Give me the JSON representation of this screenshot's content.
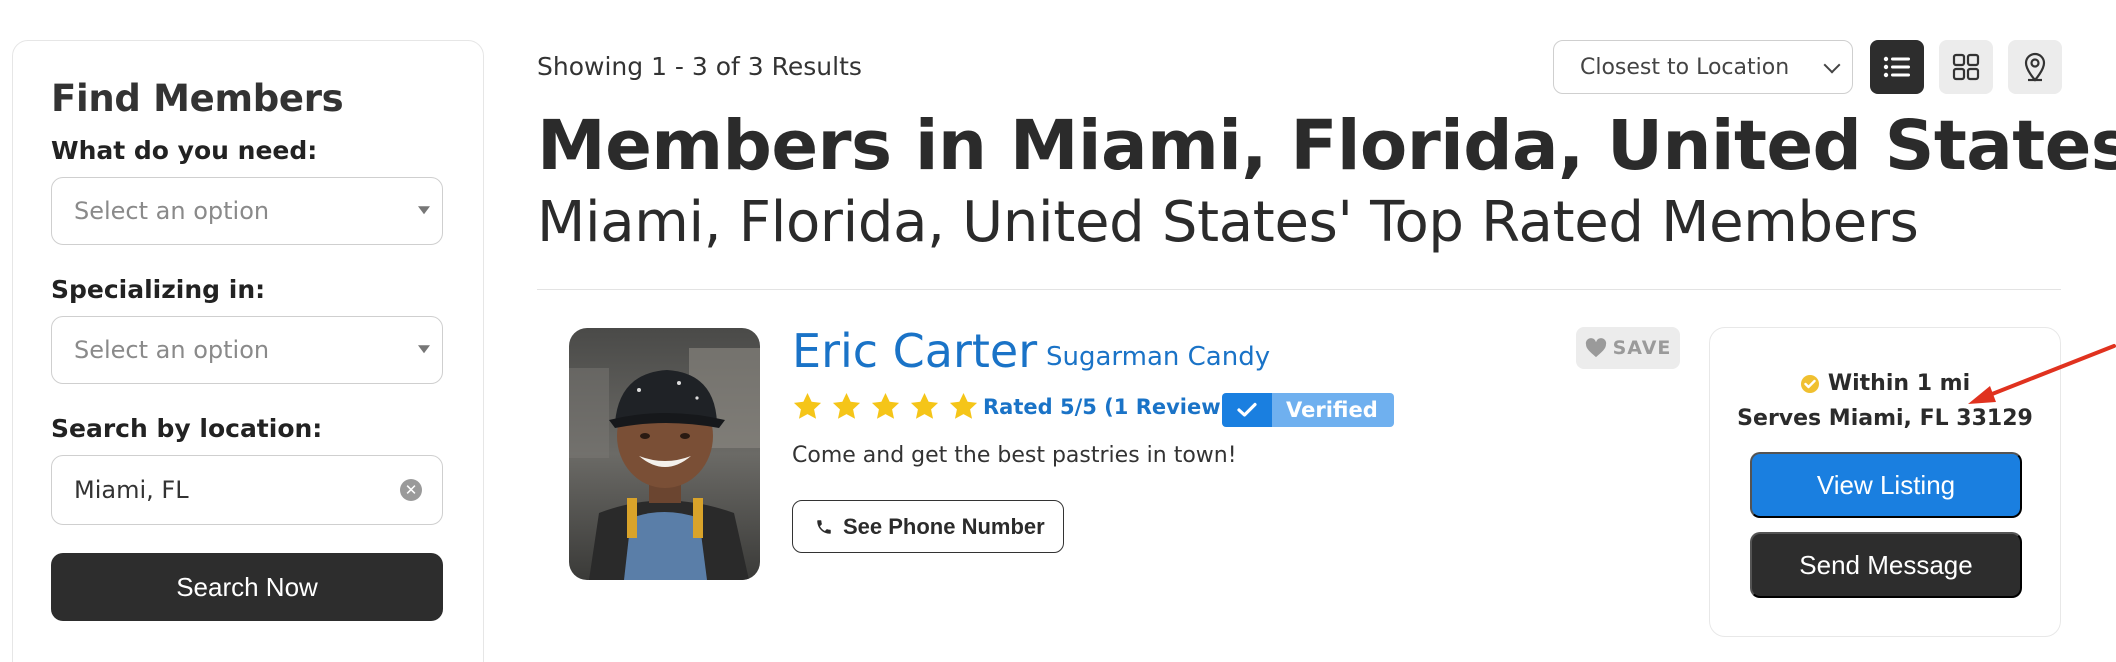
{
  "sidebar": {
    "title": "Find Members",
    "need_label": "What do you need:",
    "need_placeholder": "Select an option",
    "specializing_label": "Specializing in:",
    "specializing_placeholder": "Select an option",
    "location_label": "Search by location:",
    "location_value": "Miami, FL",
    "search_button": "Search Now"
  },
  "toolbar": {
    "results_text": "Showing 1 - 3 of 3 Results",
    "sort_value": "Closest to Location"
  },
  "page": {
    "title": "Members in Miami, Florida, United States",
    "subtitle": "Miami, Florida, United States' Top Rated Members"
  },
  "member": {
    "name": "Eric Carter",
    "company": "Sugarman Candy",
    "stars": 5,
    "rating_text": "Rated 5/5 (1 Review)",
    "verified_label": "Verified",
    "tagline": "Come and get the best pastries in town!",
    "phone_button": "See Phone Number",
    "save_label": "SAVE",
    "within_text": "Within 1 mi",
    "serves_text": "Serves Miami, FL 33129",
    "view_listing_button": "View Listing",
    "send_message_button": "Send Message"
  },
  "colors": {
    "accent_blue": "#1a7fe0",
    "link_blue": "#1a73c7",
    "dark_button": "#2d2d2d",
    "star_yellow": "#f5c518",
    "annotation_red": "#e0321f"
  },
  "icons": {
    "list_view": "list-icon",
    "grid_view": "grid-icon",
    "map_view": "map-pin-icon",
    "phone": "phone-icon",
    "save": "heart-icon",
    "verified": "check-icon",
    "within": "check-circle-icon",
    "clear": "clear-icon",
    "annotation": "arrow-icon"
  }
}
